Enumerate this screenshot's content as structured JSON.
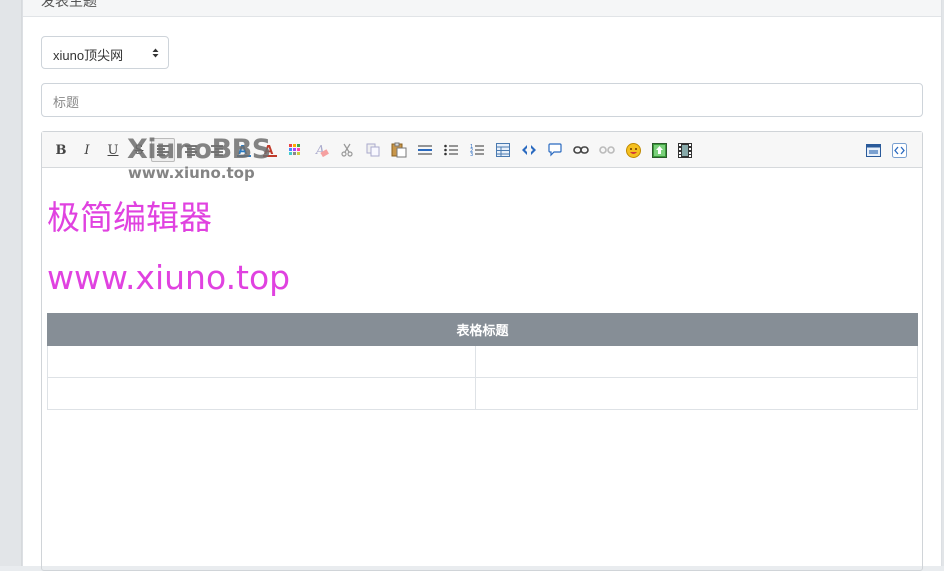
{
  "header": {
    "title": "发表主题"
  },
  "forum_select": {
    "value": "xiuno顶尖网"
  },
  "title_field": {
    "placeholder": "标题"
  },
  "toolbar": {
    "bold": "B",
    "italic": "I",
    "underline": "U",
    "strike": "S"
  },
  "watermark": {
    "brand": "XiunoBBS",
    "url": "www.xiuno.top"
  },
  "content": {
    "heading": "极简编辑器",
    "url_line": "www.xiuno.top",
    "table": {
      "caption": "表格标题",
      "rows": [
        [
          "",
          ""
        ],
        [
          "",
          ""
        ]
      ]
    }
  },
  "colors": {
    "content_text": "#e042e0",
    "table_header": "#868e96"
  }
}
